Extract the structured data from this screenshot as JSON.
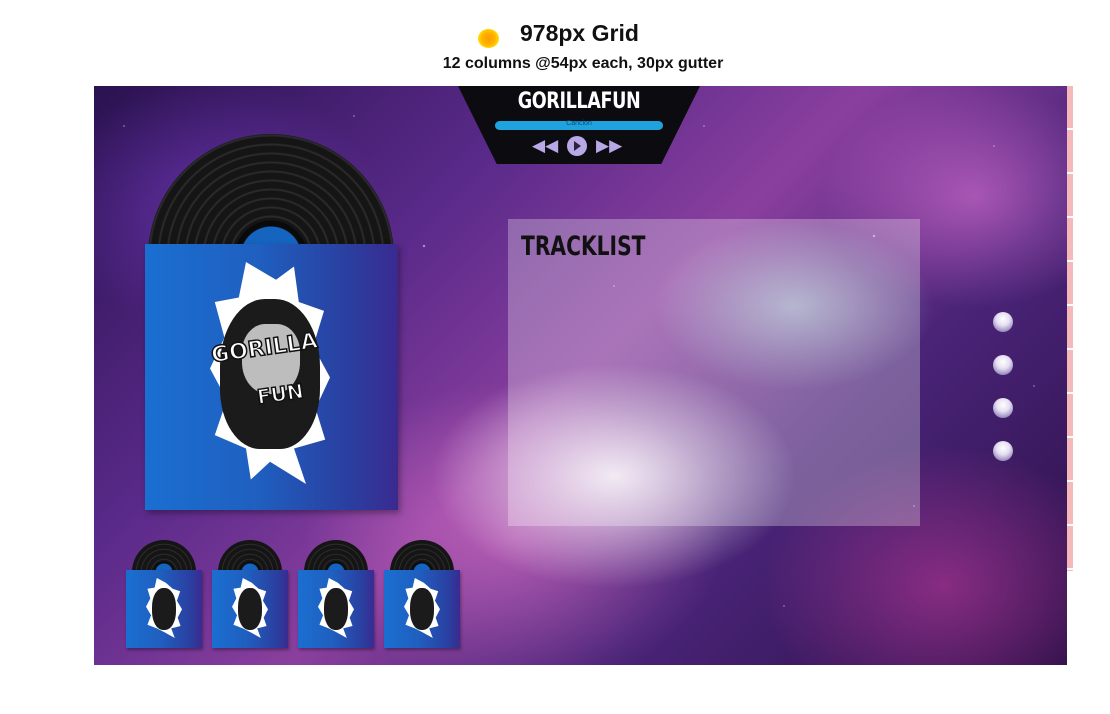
{
  "grid": {
    "title": "978px Grid",
    "subtitle": "12 columns @54px each, 30px gutter"
  },
  "player": {
    "title": "GORILLAFUN",
    "track_label": "Cancion",
    "prev_icon": "rewind-icon",
    "play_icon": "play-icon",
    "next_icon": "fast-forward-icon",
    "accent_color": "#1fa3df"
  },
  "album": {
    "logo_line_1": "GORILLA",
    "logo_line_2": "FUN",
    "sleeve_color": "#1a6fd1"
  },
  "tracklist": {
    "title": "TRACKLIST"
  },
  "side_nav": {
    "dots": [
      "nav-dot",
      "nav-dot",
      "nav-dot",
      "nav-dot"
    ]
  },
  "mini_albums": [
    "album-thumb",
    "album-thumb",
    "album-thumb",
    "album-thumb"
  ]
}
